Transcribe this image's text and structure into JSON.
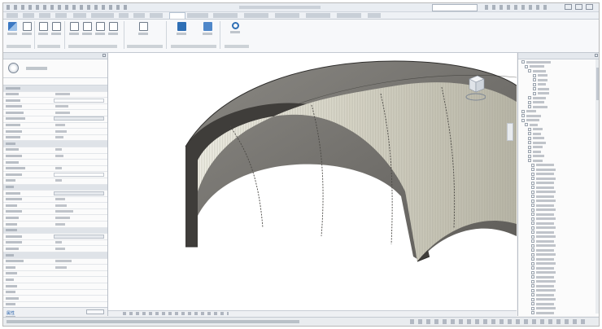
{
  "app": {
    "accent": "#2f6fb5",
    "qa_icons": [
      "open-icon",
      "save-icon",
      "undo-icon",
      "redo-icon",
      "print-icon",
      "measure-icon",
      "text-icon",
      "3d-view-icon"
    ]
  },
  "ribbon": {
    "buttons": [
      {
        "name": "modify-tool",
        "icon": "cursor-icon"
      },
      {
        "name": "family-tool-1",
        "icon": "family-icon"
      },
      {
        "name": "family-tool-2",
        "icon": "family-icon"
      },
      {
        "name": "family-tool-3",
        "icon": "family-icon"
      },
      {
        "name": "family-tool-4",
        "icon": "family-icon"
      },
      {
        "name": "family-tool-5",
        "icon": "family-icon"
      },
      {
        "name": "family-tool-6",
        "icon": "family-icon"
      },
      {
        "name": "extension-tool",
        "icon": "extension-icon"
      },
      {
        "name": "document-tool",
        "icon": "document-icon"
      },
      {
        "name": "search-tool",
        "icon": "search-icon"
      }
    ]
  },
  "properties": {
    "type_icon": "family-type-icon",
    "panel_label": "属性"
  },
  "viewport": {
    "model": "tunnel-lining",
    "outer_color": "#6f6d69",
    "inner_color": "#d9d7c9",
    "ring_color": "#5b5955"
  },
  "viewcube": {
    "icon": "viewcube-icon"
  }
}
